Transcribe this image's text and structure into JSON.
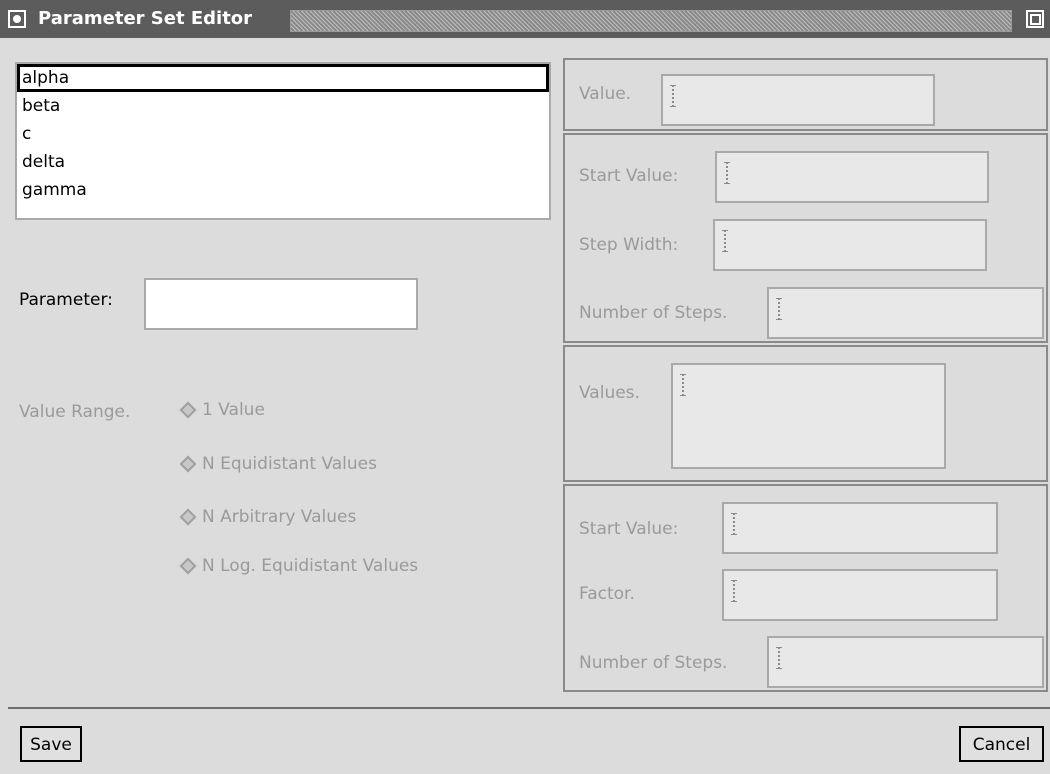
{
  "window": {
    "title": "Parameter Set Editor"
  },
  "parameter_list": {
    "items": [
      "alpha",
      "beta",
      "c",
      "delta",
      "gamma"
    ],
    "selected_index": 0
  },
  "parameter_field": {
    "label": "Parameter:",
    "value": ""
  },
  "value_range": {
    "label": "Value Range.",
    "options": [
      "1 Value",
      "N Equidistant Values",
      "N Arbitrary Values",
      "N Log. Equidistant Values"
    ]
  },
  "single_value_panel": {
    "value_label": "Value."
  },
  "equidistant_panel": {
    "start_label": "Start Value:",
    "step_label": "Step Width:",
    "steps_label": "Number of Steps."
  },
  "arbitrary_panel": {
    "values_label": "Values."
  },
  "log_panel": {
    "start_label": "Start Value:",
    "factor_label": "Factor.",
    "steps_label": "Number of Steps."
  },
  "buttons": {
    "save": "Save",
    "cancel": "Cancel"
  }
}
